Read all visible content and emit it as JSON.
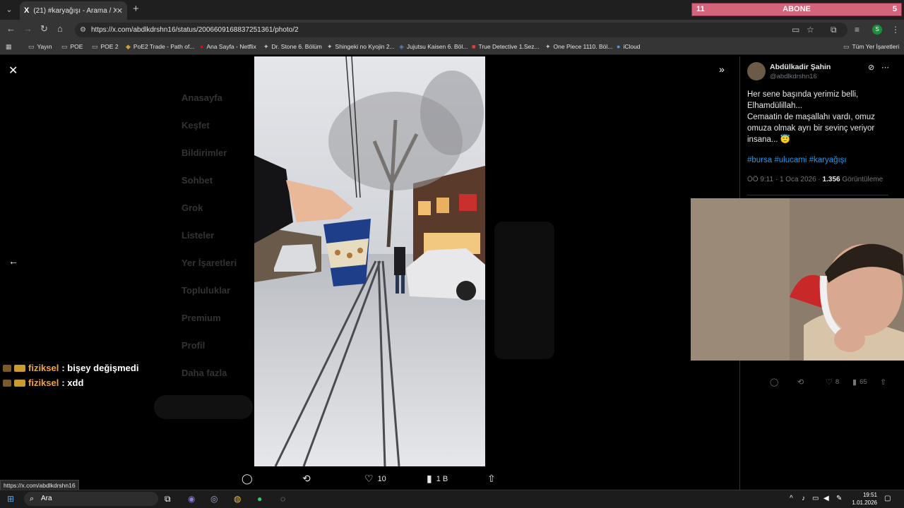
{
  "browser": {
    "tab_title": "(21) #karyağışı - Arama / X",
    "tab_favicon": "X",
    "url": "https://x.com/abdlkdrshn16/status/2006609168837251361/photo/2",
    "profile_initial": "S",
    "bookmarks": [
      {
        "icon": "folder-icon",
        "label": "Yayın"
      },
      {
        "icon": "folder-icon",
        "label": "POE"
      },
      {
        "icon": "folder-icon",
        "label": "POE 2"
      },
      {
        "icon": "poe-icon",
        "label": "PoE2 Trade - Path of..."
      },
      {
        "icon": "netflix-icon",
        "label": "Ana Sayfa - Netflix"
      },
      {
        "icon": "site-icon",
        "label": "Dr. Stone 6. Bölüm"
      },
      {
        "icon": "site-icon",
        "label": "Shingeki no Kyojin 2..."
      },
      {
        "icon": "site-icon",
        "label": "Jujutsu Kaisen 6. Böl..."
      },
      {
        "icon": "site-icon",
        "label": "True Detective 1.Sez..."
      },
      {
        "icon": "site-icon",
        "label": "One Piece 1110. Böl..."
      },
      {
        "icon": "icloud-icon",
        "label": "iCloud"
      }
    ],
    "all_bookmarks": "Tüm Yer İşaretleri",
    "status_link": "https://x.com/abdlkdrshn16"
  },
  "overlay": {
    "abone_left": "11",
    "abone_label": "ABONE",
    "abone_right": "5"
  },
  "background_nav": [
    "Anasayfa",
    "Keşfet",
    "Bildirimler",
    "Sohbet",
    "Grok",
    "Listeler",
    "Yer İşaretleri",
    "Topluluklar",
    "Premium",
    "Profil",
    "Daha fazla"
  ],
  "photo_actions": {
    "replies": "",
    "reposts": "",
    "likes": "10",
    "views": "1 B"
  },
  "tweet": {
    "display_name": "Abdülkadir Şahin",
    "handle": "@abdlkdrshn16",
    "text": "Her sene başında yerimiz belli,\nElhamdülillah...\nCemaatin de maşallahı vardı, omuz omuza olmak ayrı bir sevinç veriyor insana... 😇",
    "hashtags": "#bursa #ulucami #karyağışı",
    "time": "ÖÖ 9:11 · 1 Oca 2026 · ",
    "views_count": "1.356",
    "views_label": " Görüntüleme",
    "replies": "",
    "reposts": "",
    "likes": "8",
    "views": "65"
  },
  "chat": [
    {
      "user": "fiziksel",
      "message": ": bişey değişmedi"
    },
    {
      "user": "fiziksel",
      "message": ": xdd"
    }
  ],
  "taskbar": {
    "search_placeholder": "Ara",
    "time": "19:51",
    "date": "1.01.2026"
  }
}
